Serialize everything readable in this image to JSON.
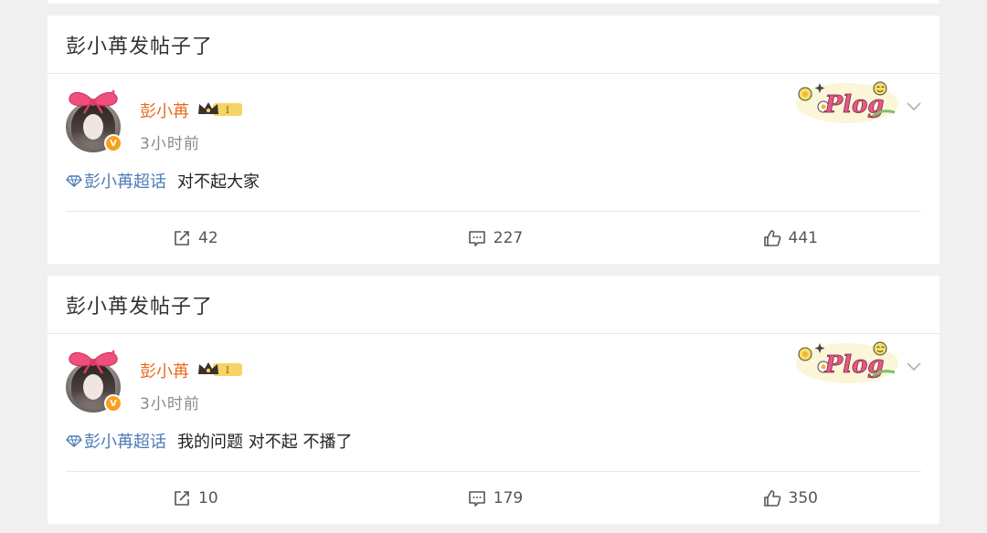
{
  "posts": [
    {
      "header_title": "彭小苒发帖子了",
      "username": "彭小苒",
      "level_badge": "I",
      "time": "3小时前",
      "sticker_text": "Plog",
      "topic": "彭小苒超话",
      "text": "对不起大家",
      "reposts": "42",
      "comments": "227",
      "likes": "441"
    },
    {
      "header_title": "彭小苒发帖子了",
      "username": "彭小苒",
      "level_badge": "I",
      "time": "3小时前",
      "sticker_text": "Plog",
      "topic": "彭小苒超话",
      "text": "我的问题 对不起 不播了",
      "reposts": "10",
      "comments": "179",
      "likes": "350"
    }
  ],
  "icons": {
    "avatar_badge": "V",
    "repost": "repost-icon",
    "comment": "comment-icon",
    "like": "like-icon",
    "chevron": "chevron-down-icon",
    "topic": "supertopic-diamond-icon"
  },
  "colors": {
    "username": "#e86b1e",
    "topic": "#4a7bb7",
    "verified": "#f7a01c",
    "page_bg": "#f0f0f1"
  }
}
